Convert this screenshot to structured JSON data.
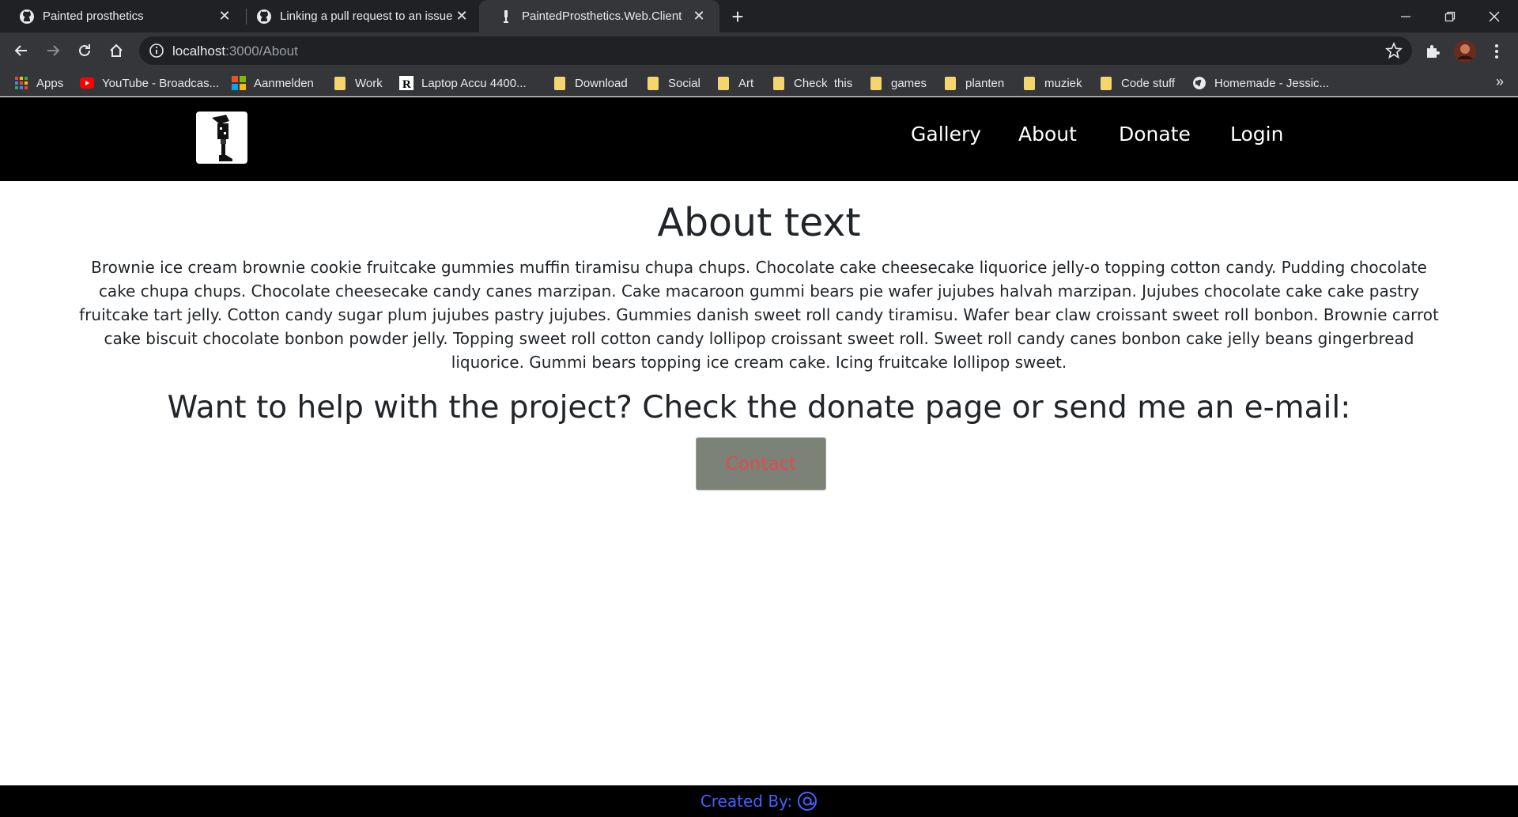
{
  "browser": {
    "tabs": [
      {
        "title": "Painted prosthetics",
        "favicon": "github-icon"
      },
      {
        "title": "Linking a pull request to an issue",
        "favicon": "github-icon"
      },
      {
        "title": "PaintedProsthetics.Web.Client",
        "favicon": "prosthetic-leg-icon",
        "active": true
      }
    ],
    "url_host": "localhost",
    "url_path": ":3000/About",
    "bookmarks": [
      {
        "label": "Apps",
        "icon": "apps-grid-icon"
      },
      {
        "label": "YouTube - Broadcas...",
        "icon": "youtube-icon"
      },
      {
        "label": "Aanmelden",
        "icon": "microsoft-icon"
      },
      {
        "label": "Work",
        "icon": "folder-icon"
      },
      {
        "label": "Laptop Accu 4400...",
        "icon": "r-logo-icon"
      },
      {
        "label": "Download",
        "icon": "folder-icon"
      },
      {
        "label": "Social",
        "icon": "folder-icon"
      },
      {
        "label": "Art",
        "icon": "folder-icon"
      },
      {
        "label": "Check  this",
        "icon": "folder-icon"
      },
      {
        "label": "games",
        "icon": "folder-icon"
      },
      {
        "label": "planten",
        "icon": "folder-icon"
      },
      {
        "label": "muziek",
        "icon": "folder-icon"
      },
      {
        "label": "Code stuff",
        "icon": "folder-icon"
      },
      {
        "label": "Homemade - Jessic...",
        "icon": "globe-icon"
      }
    ],
    "bookmarks_overflow": "»"
  },
  "site": {
    "nav": [
      "Gallery",
      "About",
      "Donate",
      "Login"
    ],
    "title": "About text",
    "body": "Brownie ice cream brownie cookie fruitcake gummies muffin tiramisu chupa chups. Chocolate cake cheesecake liquorice jelly-o topping cotton candy. Pudding chocolate cake chupa chups. Chocolate cheesecake candy canes marzipan. Cake macaroon gummi bears pie wafer jujubes halvah marzipan. Jujubes chocolate cake cake pastry fruitcake tart jelly. Cotton candy sugar plum jujubes pastry jujubes. Gummies danish sweet roll candy tiramisu. Wafer bear claw croissant sweet roll bonbon. Brownie carrot cake biscuit chocolate bonbon powder jelly. Topping sweet roll cotton candy lollipop croissant sweet roll. Sweet roll candy canes bonbon cake jelly beans gingerbread liquorice. Gummi bears topping ice cream cake. Icing fruitcake lollipop sweet.",
    "help_line": "Want to help with the project? Check the donate page or send me an e-mail:",
    "contact_label": "Contact",
    "footer_text": "Created By:"
  },
  "colors": {
    "chrome_dark": "#202124",
    "chrome_toolbar": "#35363a",
    "nav_bg": "#000000",
    "contact_bg": "#7c8278",
    "contact_text": "#e24b4b",
    "footer_link": "#3f63ff"
  }
}
